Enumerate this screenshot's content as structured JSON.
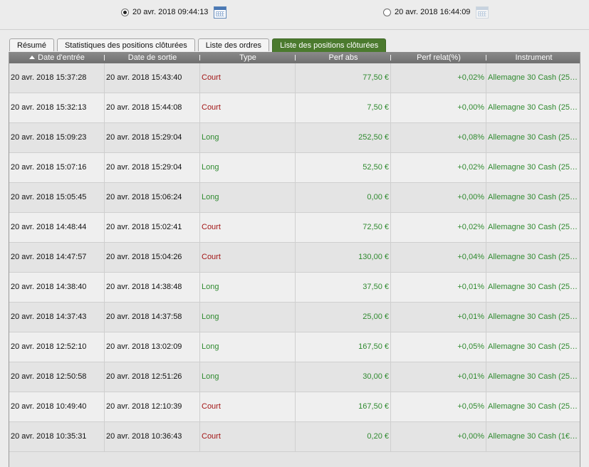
{
  "period": {
    "start": {
      "label": "20 avr. 2018 09:44:13",
      "selected": true,
      "icon": "calendar-icon"
    },
    "end": {
      "label": "20 avr. 2018 16:44:09",
      "selected": false,
      "icon": "calendar-icon"
    }
  },
  "tabs": [
    {
      "label": "Résumé",
      "active": false
    },
    {
      "label": "Statistiques des positions clôturées",
      "active": false
    },
    {
      "label": "Liste des ordres",
      "active": false
    },
    {
      "label": "Liste des positions clôturées",
      "active": true
    }
  ],
  "colors": {
    "accent": "#4b7a2e",
    "gain": "#2f8a2f",
    "short": "#a31616",
    "header": "#7a7a7a"
  },
  "table": {
    "sorted_column": 0,
    "sort_icon": "arrow-up-icon",
    "columns": [
      "Date d'entrée",
      "Date de sortie",
      "Type",
      "Perf abs",
      "Perf relat(%)",
      "Instrument"
    ],
    "rows": [
      {
        "entry": "20 avr. 2018 15:37:28",
        "exit": "20 avr. 2018 15:43:40",
        "type": "Court",
        "perf_abs": "77,50 €",
        "perf_rel": "+0,02%",
        "instrument": "Allemagne 30 Cash (25€..."
      },
      {
        "entry": "20 avr. 2018 15:32:13",
        "exit": "20 avr. 2018 15:44:08",
        "type": "Court",
        "perf_abs": "7,50 €",
        "perf_rel": "+0,00%",
        "instrument": "Allemagne 30 Cash (25€..."
      },
      {
        "entry": "20 avr. 2018 15:09:23",
        "exit": "20 avr. 2018 15:29:04",
        "type": "Long",
        "perf_abs": "252,50 €",
        "perf_rel": "+0,08%",
        "instrument": "Allemagne 30 Cash (25€..."
      },
      {
        "entry": "20 avr. 2018 15:07:16",
        "exit": "20 avr. 2018 15:29:04",
        "type": "Long",
        "perf_abs": "52,50 €",
        "perf_rel": "+0,02%",
        "instrument": "Allemagne 30 Cash (25€..."
      },
      {
        "entry": "20 avr. 2018 15:05:45",
        "exit": "20 avr. 2018 15:06:24",
        "type": "Long",
        "perf_abs": "0,00 €",
        "perf_rel": "+0,00%",
        "instrument": "Allemagne 30 Cash (25€..."
      },
      {
        "entry": "20 avr. 2018 14:48:44",
        "exit": "20 avr. 2018 15:02:41",
        "type": "Court",
        "perf_abs": "72,50 €",
        "perf_rel": "+0,02%",
        "instrument": "Allemagne 30 Cash (25€..."
      },
      {
        "entry": "20 avr. 2018 14:47:57",
        "exit": "20 avr. 2018 15:04:26",
        "type": "Court",
        "perf_abs": "130,00 €",
        "perf_rel": "+0,04%",
        "instrument": "Allemagne 30 Cash (25€..."
      },
      {
        "entry": "20 avr. 2018 14:38:40",
        "exit": "20 avr. 2018 14:38:48",
        "type": "Long",
        "perf_abs": "37,50 €",
        "perf_rel": "+0,01%",
        "instrument": "Allemagne 30 Cash (25€..."
      },
      {
        "entry": "20 avr. 2018 14:37:43",
        "exit": "20 avr. 2018 14:37:58",
        "type": "Long",
        "perf_abs": "25,00 €",
        "perf_rel": "+0,01%",
        "instrument": "Allemagne 30 Cash (25€..."
      },
      {
        "entry": "20 avr. 2018 12:52:10",
        "exit": "20 avr. 2018 13:02:09",
        "type": "Long",
        "perf_abs": "167,50 €",
        "perf_rel": "+0,05%",
        "instrument": "Allemagne 30 Cash (25€..."
      },
      {
        "entry": "20 avr. 2018 12:50:58",
        "exit": "20 avr. 2018 12:51:26",
        "type": "Long",
        "perf_abs": "30,00 €",
        "perf_rel": "+0,01%",
        "instrument": "Allemagne 30 Cash (25€..."
      },
      {
        "entry": "20 avr. 2018 10:49:40",
        "exit": "20 avr. 2018 12:10:39",
        "type": "Court",
        "perf_abs": "167,50 €",
        "perf_rel": "+0,05%",
        "instrument": "Allemagne 30 Cash (25€..."
      },
      {
        "entry": "20 avr. 2018 10:35:31",
        "exit": "20 avr. 2018 10:36:43",
        "type": "Court",
        "perf_abs": "0,20 €",
        "perf_rel": "+0,00%",
        "instrument": "Allemagne 30 Cash (1€) ..."
      }
    ]
  }
}
